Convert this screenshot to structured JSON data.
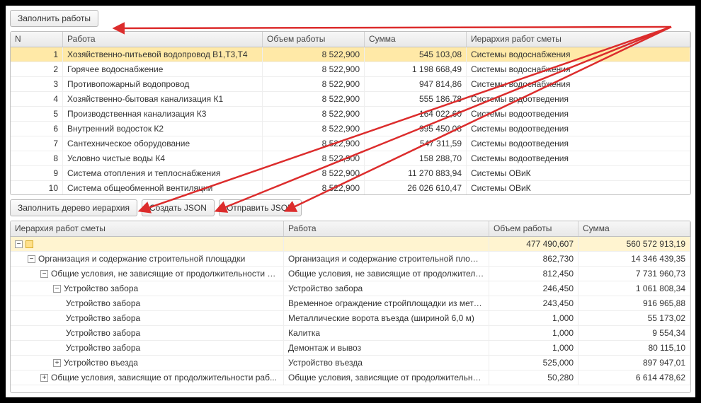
{
  "buttons": {
    "fill_works": "Заполнить работы",
    "fill_tree": "Заполнить дерево иерархия",
    "create_json": "Создать JSON",
    "send_json": "Отправить JSON"
  },
  "grid1": {
    "headers": {
      "n": "N",
      "work": "Работа",
      "volume": "Объем работы",
      "sum": "Сумма",
      "hierarchy": "Иерархия работ сметы"
    },
    "rows": [
      {
        "n": "1",
        "work": "Хозяйственно-питьевой водопровод  В1,Т3,Т4",
        "volume": "8 522,900",
        "sum": "545 103,08",
        "hierarchy": "Системы водоснабжения",
        "selected": true
      },
      {
        "n": "2",
        "work": "Горячее водоснабжение",
        "volume": "8 522,900",
        "sum": "1 198 668,49",
        "hierarchy": "Системы водоснабжения"
      },
      {
        "n": "3",
        "work": "Противопожарный водопровод",
        "volume": "8 522,900",
        "sum": "947 814,86",
        "hierarchy": "Системы водоснабжения"
      },
      {
        "n": "4",
        "work": "Хозяйственно-бытовая канализация К1",
        "volume": "8 522,900",
        "sum": "555 186,78",
        "hierarchy": "Системы водоотведения"
      },
      {
        "n": "5",
        "work": "Производственная канализация К3",
        "volume": "8 522,900",
        "sum": "164 022,60",
        "hierarchy": "Системы водоотведения"
      },
      {
        "n": "6",
        "work": "Внутренний водосток К2",
        "volume": "8 522,900",
        "sum": "995 450,08",
        "hierarchy": "Системы водоотведения"
      },
      {
        "n": "7",
        "work": "Сантехническое оборудование",
        "volume": "8 522,900",
        "sum": "547 311,59",
        "hierarchy": "Системы водоотведения"
      },
      {
        "n": "8",
        "work": "Условно чистые воды К4",
        "volume": "8 522,900",
        "sum": "158 288,70",
        "hierarchy": "Системы водоотведения"
      },
      {
        "n": "9",
        "work": "Система отопления и теплоснабжения",
        "volume": "8 522,900",
        "sum": "11 270 883,94",
        "hierarchy": "Системы ОВиК"
      },
      {
        "n": "10",
        "work": "Система общеобменной вентиляции",
        "volume": "8 522,900",
        "sum": "26 026 610,47",
        "hierarchy": "Системы ОВиК"
      }
    ]
  },
  "grid2": {
    "headers": {
      "hierarchy": "Иерархия работ сметы",
      "work": "Работа",
      "volume": "Объем работы",
      "sum": "Сумма"
    },
    "rows": [
      {
        "level": 0,
        "toggle": "−",
        "block": true,
        "h": "",
        "w": "",
        "v": "477 490,607",
        "s": "560 572 913,19",
        "total": true
      },
      {
        "level": 1,
        "toggle": "−",
        "h": "Организация и содержание строительной площадки",
        "w": "Организация и содержание строительной площа...",
        "v": "862,730",
        "s": "14 346 439,35"
      },
      {
        "level": 2,
        "toggle": "−",
        "h": "Общие условия, не зависящие от продолжительности ра...",
        "w": "Общие условия, не зависящие от продолжитель...",
        "v": "812,450",
        "s": "7 731 960,73"
      },
      {
        "level": 3,
        "toggle": "−",
        "h": "Устройство забора",
        "w": "Устройство забора",
        "v": "246,450",
        "s": "1 061 808,34"
      },
      {
        "level": 4,
        "h": "Устройство забора",
        "w": "Временное ограждение стройплощадки из мета...",
        "v": "243,450",
        "s": "916 965,88"
      },
      {
        "level": 4,
        "h": "Устройство забора",
        "w": "Металлические ворота въезда (шириной 6,0 м)",
        "v": "1,000",
        "s": "55 173,02"
      },
      {
        "level": 4,
        "h": "Устройство забора",
        "w": "Калитка",
        "v": "1,000",
        "s": "9 554,34"
      },
      {
        "level": 4,
        "h": "Устройство забора",
        "w": "Демонтаж и вывоз",
        "v": "1,000",
        "s": "80 115,10"
      },
      {
        "level": 3,
        "toggle": "+",
        "h": "Устройство въезда",
        "w": "Устройство въезда",
        "v": "525,000",
        "s": "897 947,01"
      },
      {
        "level": 2,
        "toggle": "+",
        "h": "Общие условия, зависящие от продолжительности раб...",
        "w": "Общие условия, зависящие от продолжительно...",
        "v": "50,280",
        "s": "6 614 478,62"
      }
    ]
  }
}
